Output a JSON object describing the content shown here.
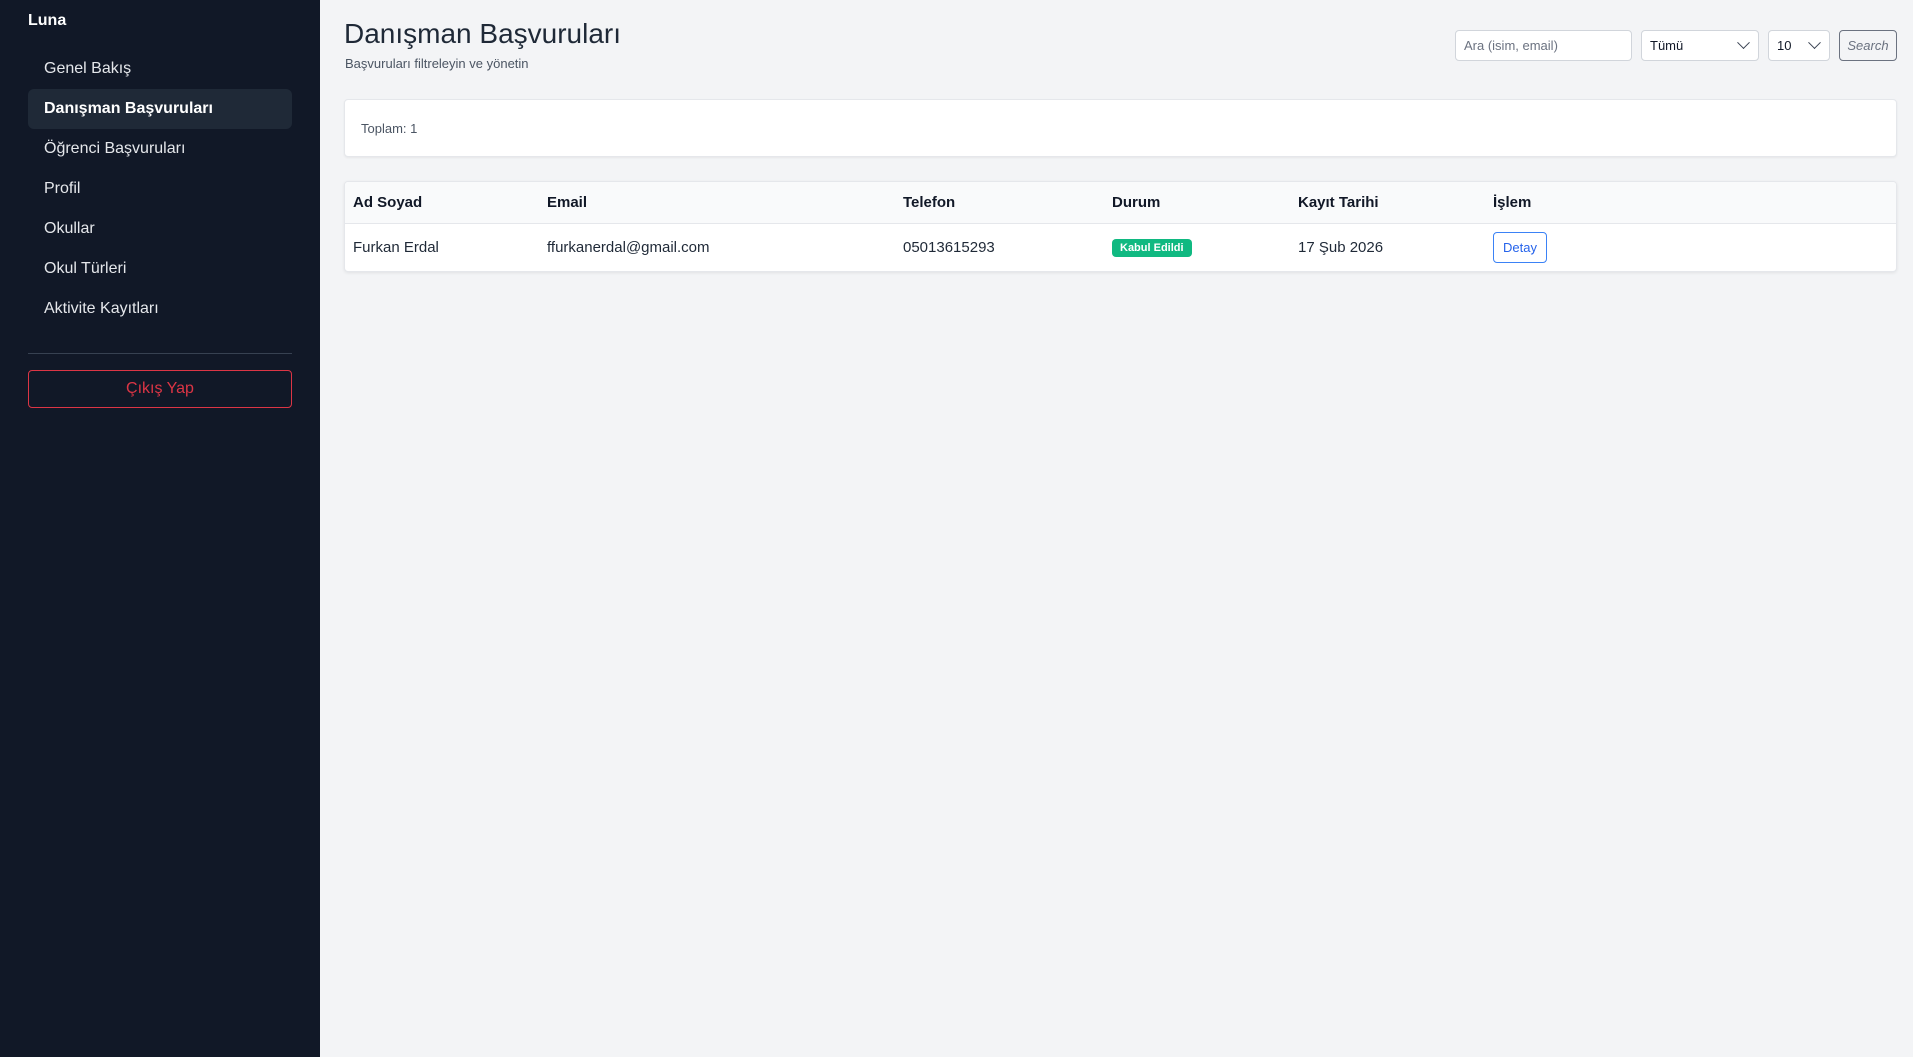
{
  "app": {
    "name": "Luna"
  },
  "sidebar": {
    "items": [
      {
        "label": "Genel Bakış",
        "active": false
      },
      {
        "label": "Danışman Başvuruları",
        "active": true
      },
      {
        "label": "Öğrenci Başvuruları",
        "active": false
      },
      {
        "label": "Profil",
        "active": false
      },
      {
        "label": "Okullar",
        "active": false
      },
      {
        "label": "Okul Türleri",
        "active": false
      },
      {
        "label": "Aktivite Kayıtları",
        "active": false
      }
    ],
    "logout_label": "Çıkış Yap"
  },
  "header": {
    "title": "Danışman Başvuruları",
    "subtitle": "Başvuruları filtreleyin ve yönetin"
  },
  "filters": {
    "search_placeholder": "Ara (isim, email)",
    "search_value": "",
    "status_selected": "Tümü",
    "page_size_selected": "10",
    "search_button_label": "Search"
  },
  "summary": {
    "total_text": "Toplam: 1"
  },
  "table": {
    "columns": [
      "Ad Soyad",
      "Email",
      "Telefon",
      "Durum",
      "Kayıt Tarihi",
      "İşlem"
    ],
    "rows": [
      {
        "name": "Furkan Erdal",
        "email": "ffurkanerdal@gmail.com",
        "phone": "05013615293",
        "status": "Kabul Edildi",
        "date": "17 Şub 2026",
        "action_label": "Detay"
      }
    ]
  },
  "colors": {
    "sidebar_bg": "#111827",
    "active_item_bg": "#1f2937",
    "danger": "#dc3545",
    "success_badge": "#10b981",
    "primary": "#2563eb",
    "page_bg": "#f3f4f6"
  },
  "icons": {
    "select_arrow": "chevron-down-icon"
  }
}
